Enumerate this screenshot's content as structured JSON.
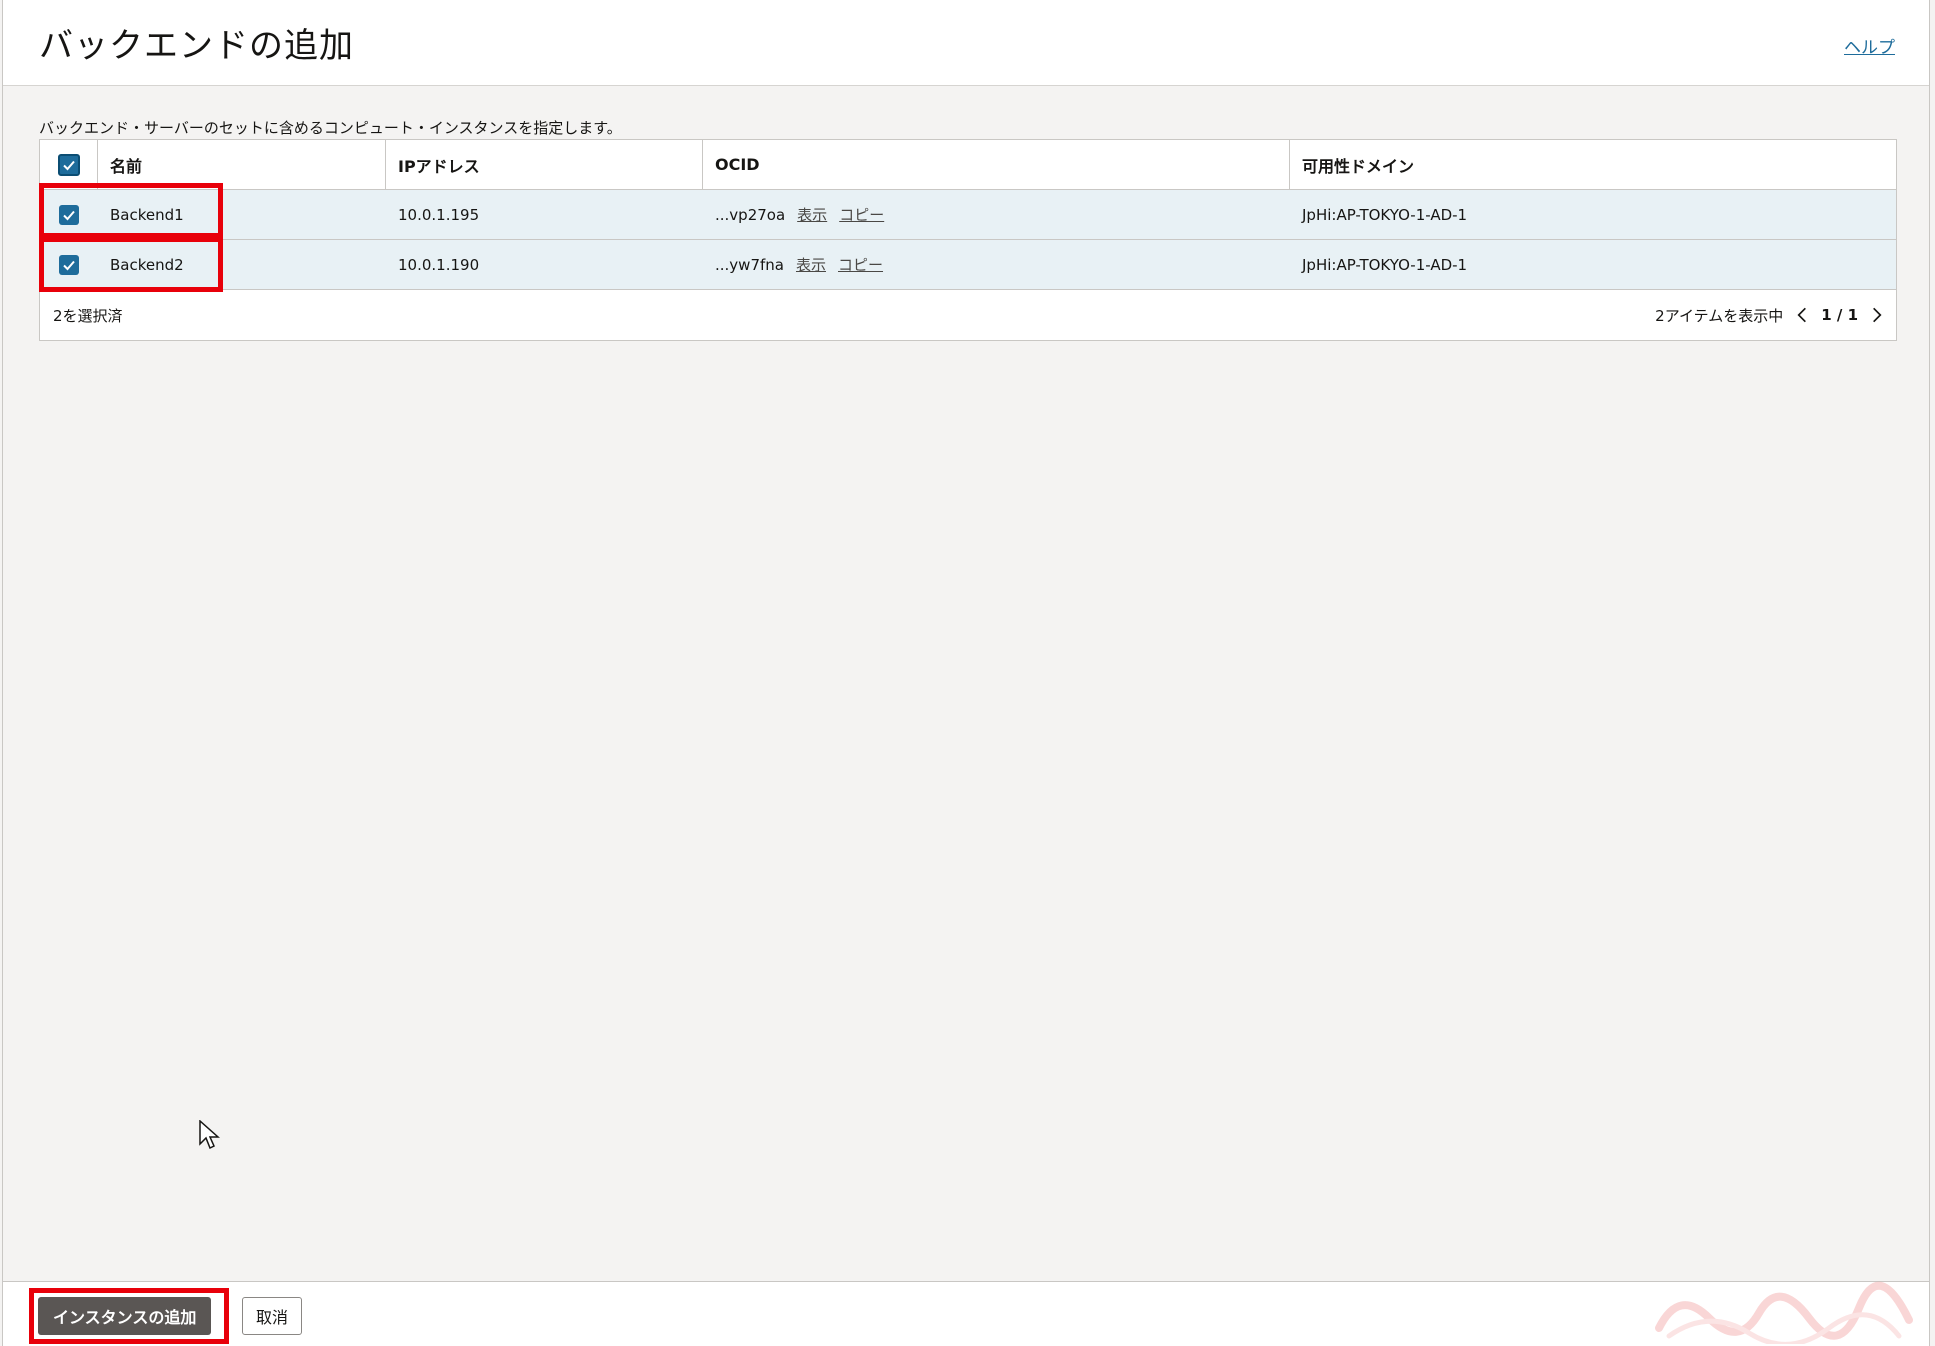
{
  "header": {
    "title": "バックエンドの追加",
    "help": "ヘルプ"
  },
  "description": "バックエンド・サーバーのセットに含めるコンピュート・インスタンスを指定します。",
  "table": {
    "columns": [
      "名前",
      "IPアドレス",
      "OCID",
      "可用性ドメイン"
    ],
    "rows": [
      {
        "checked": true,
        "name": "Backend1",
        "ip": "10.0.1.195",
        "ocid": "...vp27oa",
        "show": "表示",
        "copy": "コピー",
        "ad": "JpHi:AP-TOKYO-1-AD-1"
      },
      {
        "checked": true,
        "name": "Backend2",
        "ip": "10.0.1.190",
        "ocid": "...yw7fna",
        "show": "表示",
        "copy": "コピー",
        "ad": "JpHi:AP-TOKYO-1-AD-1"
      }
    ],
    "selected_text": "2を選択済",
    "items_text": "2アイテムを表示中",
    "page_text": "1 / 1"
  },
  "buttons": {
    "add": "インスタンスの追加",
    "cancel": "取消"
  },
  "colors": {
    "accent": "#1e6c9b",
    "highlight": "#e8000a",
    "row_selected": "#e8f1f5"
  }
}
